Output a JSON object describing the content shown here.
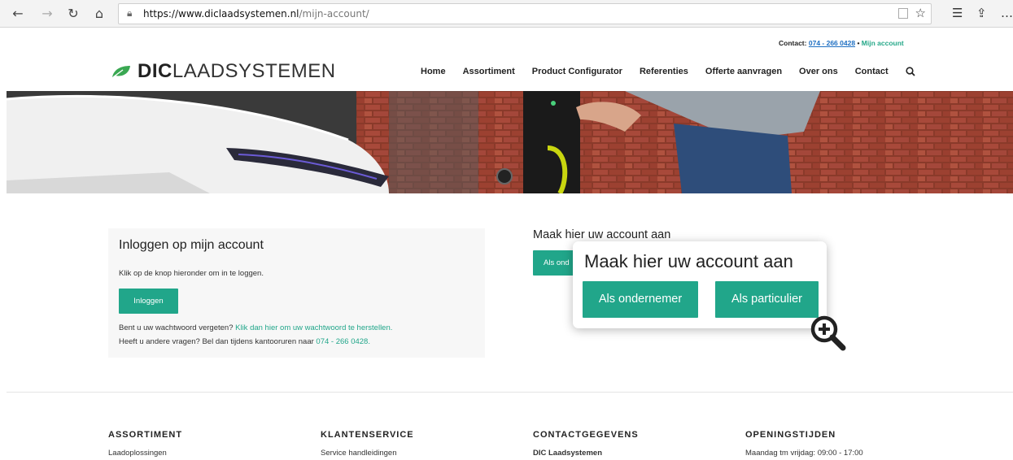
{
  "browser": {
    "url_domain": "https://www.diclaadsystemen.nl",
    "url_path": "/mijn-account/",
    "icons": [
      "back-icon",
      "forward-icon",
      "refresh-icon",
      "home-icon",
      "lock-icon",
      "reading-view-icon",
      "favorite-star-icon",
      "favorites-list-icon",
      "share-icon",
      "more-icon"
    ]
  },
  "topbar": {
    "contact_label": "Contact:",
    "phone": "074 - 266 0428",
    "separator": "•",
    "account_link": "Mijn account"
  },
  "header": {
    "logo_bold": "DIC",
    "logo_light": "LAADSYSTEMEN",
    "nav": [
      "Home",
      "Assortiment",
      "Product Configurator",
      "Referenties",
      "Offerte aanvragen",
      "Over ons",
      "Contact"
    ]
  },
  "login": {
    "title": "Inloggen op mijn account",
    "description": "Klik op de knop hieronder om in te loggen.",
    "button": "Inloggen",
    "forgot_text": "Bent u uw wachtwoord vergeten?",
    "forgot_link": "Klik dan hier om uw wachtwoord te herstellen.",
    "questions_text": "Heeft u andere vragen? Bel dan tijdens kantooruren naar",
    "questions_phone": "074 - 266 0428."
  },
  "create_account": {
    "title": "Maak hier uw account aan",
    "button_partial": "Als ond"
  },
  "zoom_popup": {
    "title": "Maak hier uw account aan",
    "button_business": "Als ondernemer",
    "button_private": "Als particulier"
  },
  "footer": {
    "columns": [
      {
        "heading": "ASSORTIMENT",
        "item": "Laadoplossingen"
      },
      {
        "heading": "KLANTENSERVICE",
        "item": "Service handleidingen"
      },
      {
        "heading": "CONTACTGEGEVENS",
        "item": "DIC Laadsystemen"
      },
      {
        "heading": "OPENINGSTIJDEN",
        "item": "Maandag tm vrijdag: 09:00 - 17:00"
      }
    ]
  },
  "colors": {
    "brand_green": "#21a68a",
    "link_blue": "#1e6fc2",
    "text_dark": "#222222"
  }
}
